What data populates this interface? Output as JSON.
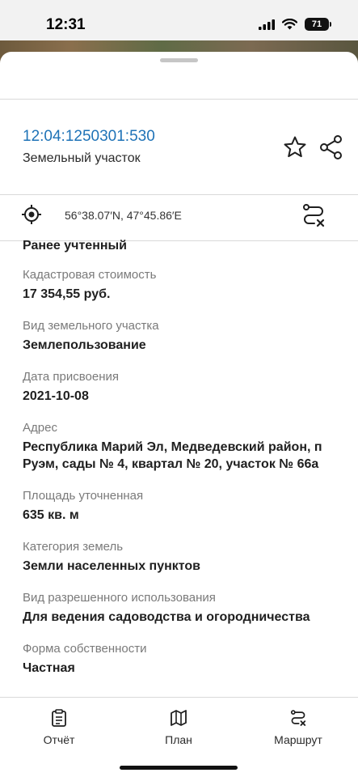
{
  "status_bar": {
    "time": "12:31",
    "battery": "71"
  },
  "header": {
    "cadastral_number": "12:04:1250301:530",
    "object_type": "Земельный участок"
  },
  "location": {
    "coordinates": "56°38.07′N, 47°45.86′E"
  },
  "details": {
    "status": "Ранее учтенный",
    "fields": [
      {
        "label": "Кадастровая стоимость",
        "value": "17 354,55 руб."
      },
      {
        "label": "Вид земельного участка",
        "value": "Землепользование"
      },
      {
        "label": "Дата присвоения",
        "value": "2021-10-08"
      },
      {
        "label": "Адрес",
        "value": "Республика Марий Эл, Медведевский район, п Руэм, сады № 4, квартал № 20, участок № 66а"
      },
      {
        "label": "Площадь уточненная",
        "value": "635 кв. м"
      },
      {
        "label": "Категория земель",
        "value": "Земли населенных пунктов"
      },
      {
        "label": "Вид разрешенного использования",
        "value": "Для ведения садоводства и огородничества"
      },
      {
        "label": "Форма собственности",
        "value": "Частная"
      }
    ]
  },
  "tabbar": {
    "report_label": "Отчёт",
    "plan_label": "План",
    "route_label": "Маршрут"
  },
  "colors": {
    "accent": "#1f73b7",
    "label_gray": "#7a7a7a"
  },
  "icons": [
    "signal-icon",
    "wifi-icon",
    "battery-icon",
    "star-icon",
    "share-icon",
    "locate-icon",
    "route-cancel-icon",
    "report-icon",
    "map-icon",
    "route-icon"
  ]
}
